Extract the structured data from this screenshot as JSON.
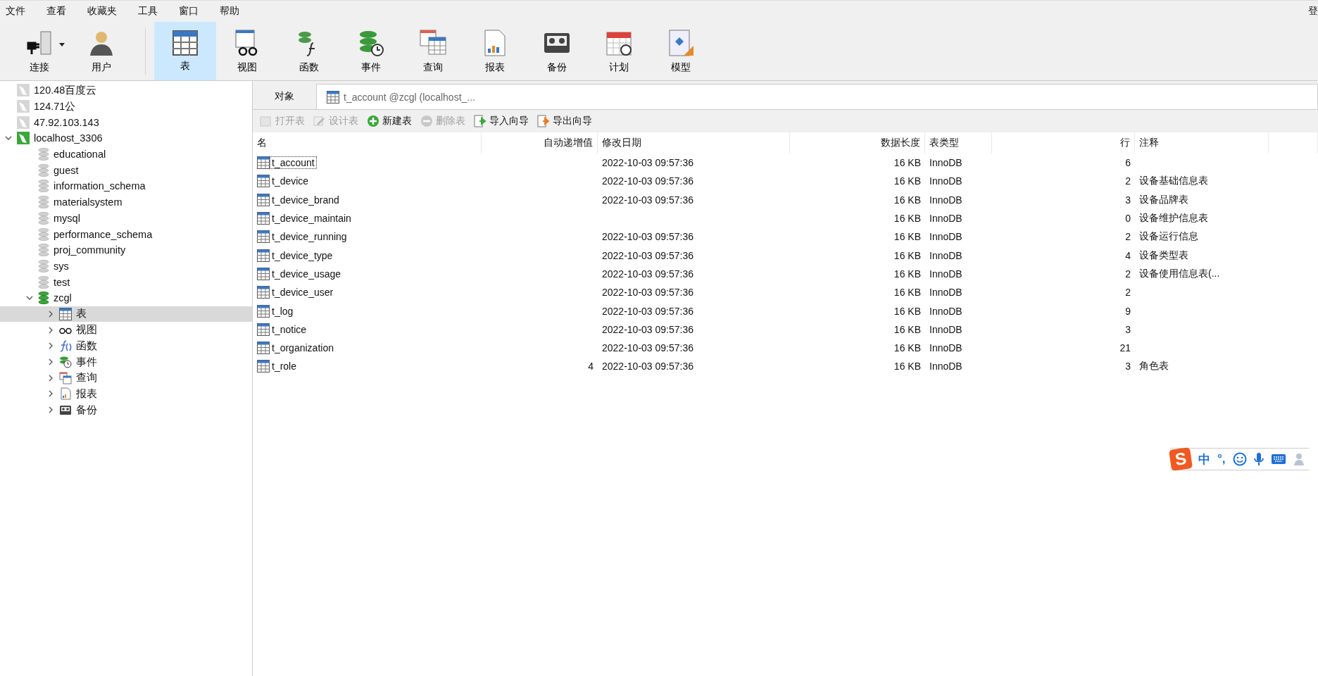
{
  "menu": [
    "文件",
    "查看",
    "收藏夹",
    "工具",
    "窗口",
    "帮助"
  ],
  "login": "登",
  "toolbar": [
    {
      "kind": "connection",
      "label": "连接",
      "dropdown": true,
      "selected": false
    },
    {
      "kind": "user",
      "label": "用户",
      "dropdown": false,
      "selected": false
    },
    {
      "kind": "table",
      "label": "表",
      "dropdown": false,
      "selected": true
    },
    {
      "kind": "view",
      "label": "视图",
      "dropdown": false,
      "selected": false
    },
    {
      "kind": "function",
      "label": "函数",
      "dropdown": false,
      "selected": false
    },
    {
      "kind": "event",
      "label": "事件",
      "dropdown": false,
      "selected": false
    },
    {
      "kind": "query",
      "label": "查询",
      "dropdown": false,
      "selected": false
    },
    {
      "kind": "report",
      "label": "报表",
      "dropdown": false,
      "selected": false
    },
    {
      "kind": "backup",
      "label": "备份",
      "dropdown": false,
      "selected": false
    },
    {
      "kind": "schedule",
      "label": "计划",
      "dropdown": false,
      "selected": false
    },
    {
      "kind": "model",
      "label": "模型",
      "dropdown": false,
      "selected": false
    }
  ],
  "sidebar": [
    {
      "kind": "connection",
      "label": "120.48百度云",
      "open": false,
      "expanded": false,
      "selected": false
    },
    {
      "kind": "connection",
      "label": "124.71公",
      "open": false,
      "expanded": false,
      "selected": false
    },
    {
      "kind": "connection",
      "label": "47.92.103.143",
      "open": false,
      "expanded": false,
      "selected": false
    },
    {
      "kind": "connection",
      "label": "localhost_3306",
      "open": true,
      "expanded": true,
      "selected": false,
      "children": [
        {
          "kind": "database",
          "label": "educational",
          "open": false,
          "expanded": false,
          "selected": false
        },
        {
          "kind": "database",
          "label": "guest",
          "open": false,
          "expanded": false,
          "selected": false
        },
        {
          "kind": "database",
          "label": "information_schema",
          "open": false,
          "expanded": false,
          "selected": false
        },
        {
          "kind": "database",
          "label": "materialsystem",
          "open": false,
          "expanded": false,
          "selected": false
        },
        {
          "kind": "database",
          "label": "mysql",
          "open": false,
          "expanded": false,
          "selected": false
        },
        {
          "kind": "database",
          "label": "performance_schema",
          "open": false,
          "expanded": false,
          "selected": false
        },
        {
          "kind": "database",
          "label": "proj_community",
          "open": false,
          "expanded": false,
          "selected": false
        },
        {
          "kind": "database",
          "label": "sys",
          "open": false,
          "expanded": false,
          "selected": false
        },
        {
          "kind": "database",
          "label": "test",
          "open": false,
          "expanded": false,
          "selected": false
        },
        {
          "kind": "database",
          "label": "zcgl",
          "open": true,
          "expanded": true,
          "selected": false,
          "children": [
            {
              "kind": "table",
              "label": "表",
              "expanded": false,
              "selected": true
            },
            {
              "kind": "view",
              "label": "视图",
              "expanded": false,
              "selected": false
            },
            {
              "kind": "function",
              "label": "函数",
              "expanded": false,
              "selected": false
            },
            {
              "kind": "event",
              "label": "事件",
              "expanded": false,
              "selected": false
            },
            {
              "kind": "query",
              "label": "查询",
              "expanded": false,
              "selected": false
            },
            {
              "kind": "report",
              "label": "报表",
              "expanded": false,
              "selected": false
            },
            {
              "kind": "backup",
              "label": "备份",
              "expanded": false,
              "selected": false
            }
          ]
        }
      ]
    }
  ],
  "tabs": [
    {
      "kind": "objects",
      "label": "对象",
      "selected": false
    },
    {
      "kind": "table",
      "label": "t_account @zcgl (localhost_...",
      "selected": true
    }
  ],
  "actions": [
    {
      "kind": "open",
      "label": "打开表",
      "disabled": true
    },
    {
      "kind": "design",
      "label": "设计表",
      "disabled": true
    },
    {
      "kind": "new",
      "label": "新建表",
      "disabled": false
    },
    {
      "kind": "delete",
      "label": "删除表",
      "disabled": true
    },
    {
      "kind": "import",
      "label": "导入向导",
      "disabled": false
    },
    {
      "kind": "export",
      "label": "导出向导",
      "disabled": false
    }
  ],
  "table": {
    "columns": [
      "名",
      "自动递增值",
      "修改日期",
      "数据长度",
      "表类型",
      "行",
      "注释"
    ],
    "rows": [
      {
        "name": "t_account",
        "modified": "2022-10-03 09:57:36",
        "data_length": "16 KB",
        "engine": "InnoDB",
        "rows": "6",
        "selected": true
      },
      {
        "name": "t_device",
        "modified": "2022-10-03 09:57:36",
        "data_length": "16 KB",
        "engine": "InnoDB",
        "rows": "2",
        "comment": "设备基础信息表",
        "selected": false
      },
      {
        "name": "t_device_brand",
        "modified": "2022-10-03 09:57:36",
        "data_length": "16 KB",
        "engine": "InnoDB",
        "rows": "3",
        "comment": "设备品牌表",
        "selected": false
      },
      {
        "name": "t_device_maintain",
        "data_length": "16 KB",
        "engine": "InnoDB",
        "rows": "0",
        "comment": "设备维护信息表",
        "selected": false
      },
      {
        "name": "t_device_running",
        "modified": "2022-10-03 09:57:36",
        "data_length": "16 KB",
        "engine": "InnoDB",
        "rows": "2",
        "comment": "设备运行信息",
        "selected": false
      },
      {
        "name": "t_device_type",
        "modified": "2022-10-03 09:57:36",
        "data_length": "16 KB",
        "engine": "InnoDB",
        "rows": "4",
        "comment": "设备类型表",
        "selected": false
      },
      {
        "name": "t_device_usage",
        "modified": "2022-10-03 09:57:36",
        "data_length": "16 KB",
        "engine": "InnoDB",
        "rows": "2",
        "comment": "设备使用信息表(...",
        "selected": false
      },
      {
        "name": "t_device_user",
        "modified": "2022-10-03 09:57:36",
        "data_length": "16 KB",
        "engine": "InnoDB",
        "rows": "2",
        "selected": false
      },
      {
        "name": "t_log",
        "modified": "2022-10-03 09:57:36",
        "data_length": "16 KB",
        "engine": "InnoDB",
        "rows": "9",
        "selected": false
      },
      {
        "name": "t_notice",
        "modified": "2022-10-03 09:57:36",
        "data_length": "16 KB",
        "engine": "InnoDB",
        "rows": "3",
        "selected": false
      },
      {
        "name": "t_organization",
        "modified": "2022-10-03 09:57:36",
        "data_length": "16 KB",
        "engine": "InnoDB",
        "rows": "21",
        "selected": false
      },
      {
        "name": "t_role",
        "auto_increment": "4",
        "modified": "2022-10-03 09:57:36",
        "data_length": "16 KB",
        "engine": "InnoDB",
        "rows": "3",
        "comment": "角色表",
        "selected": false
      }
    ]
  },
  "ime": {
    "logo": "S",
    "mode": "中",
    "punct": "°,"
  }
}
